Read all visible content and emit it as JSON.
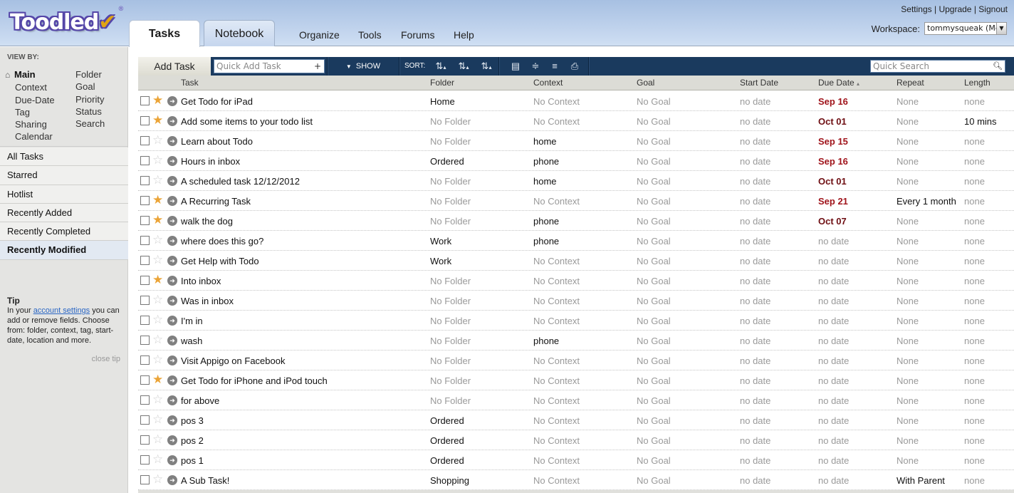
{
  "app": {
    "logo": "Toodled",
    "logo_mark": "✔",
    "logo_reg": "®"
  },
  "tabs": [
    {
      "label": "Tasks",
      "active": true
    },
    {
      "label": "Notebook",
      "active": false
    }
  ],
  "nav": [
    "Organize",
    "Tools",
    "Forums",
    "Help"
  ],
  "top_links": {
    "settings": "Settings",
    "upgrade": "Upgrade",
    "signout": "Signout",
    "separator": "|"
  },
  "workspace": {
    "label": "Workspace:",
    "value": "tommysqueak (Me)"
  },
  "sidebar": {
    "viewby_title": "VIEW BY:",
    "viewby_left": [
      "Main",
      "Context",
      "Due-Date",
      "Tag",
      "Sharing",
      "Calendar"
    ],
    "viewby_right": [
      "Folder",
      "Goal",
      "Priority",
      "Status",
      "Search"
    ],
    "lists": [
      {
        "label": "All Tasks",
        "selected": false
      },
      {
        "label": "Starred",
        "selected": false
      },
      {
        "label": "Hotlist",
        "selected": false
      },
      {
        "label": "Recently Added",
        "selected": false
      },
      {
        "label": "Recently Completed",
        "selected": false
      },
      {
        "label": "Recently Modified",
        "selected": true
      }
    ],
    "tip": {
      "title": "Tip",
      "before_link": "In your ",
      "link": "account settings",
      "after_link": " you can add or remove fields. Choose from: folder, context, tag, start-date, location and more.",
      "close": "close tip"
    }
  },
  "toolbar": {
    "add_task": "Add Task",
    "quick_add_placeholder": "Quick Add Task",
    "show": "SHOW",
    "sort_label": "SORT:",
    "quick_search_placeholder": "Quick Search"
  },
  "columns": [
    "Task",
    "Folder",
    "Context",
    "Goal",
    "Start Date",
    "Due Date",
    "Repeat",
    "Length"
  ],
  "sorted_column_indicator": "▴",
  "tasks": [
    {
      "starred": true,
      "name": "Get Todo for iPad",
      "folder": "Home",
      "context": "No Context",
      "goal": "No Goal",
      "start": "no date",
      "due": "Sep 16",
      "repeat": "None",
      "length": "none"
    },
    {
      "starred": true,
      "name": "Add some items to your todo list",
      "folder": "No Folder",
      "context": "No Context",
      "goal": "No Goal",
      "start": "no date",
      "due": "Oct 01",
      "repeat": "None",
      "length": "10 mins"
    },
    {
      "starred": false,
      "name": "Learn about Todo",
      "folder": "No Folder",
      "context": "home",
      "goal": "No Goal",
      "start": "no date",
      "due": "Sep 15",
      "repeat": "None",
      "length": "none"
    },
    {
      "starred": false,
      "name": "Hours in inbox",
      "folder": "Ordered",
      "context": "phone",
      "goal": "No Goal",
      "start": "no date",
      "due": "Sep 16",
      "repeat": "None",
      "length": "none"
    },
    {
      "starred": false,
      "name": "A scheduled task 12/12/2012",
      "folder": "No Folder",
      "context": "home",
      "goal": "No Goal",
      "start": "no date",
      "due": "Oct 01",
      "repeat": "None",
      "length": "none"
    },
    {
      "starred": true,
      "name": "A Recurring Task",
      "folder": "No Folder",
      "context": "No Context",
      "goal": "No Goal",
      "start": "no date",
      "due": "Sep 21",
      "repeat": "Every 1 month",
      "length": "none"
    },
    {
      "starred": true,
      "name": "walk the dog",
      "folder": "No Folder",
      "context": "phone",
      "goal": "No Goal",
      "start": "no date",
      "due": "Oct 07",
      "repeat": "None",
      "length": "none"
    },
    {
      "starred": false,
      "name": "where does this go?",
      "folder": "Work",
      "context": "phone",
      "goal": "No Goal",
      "start": "no date",
      "due": "no date",
      "repeat": "None",
      "length": "none"
    },
    {
      "starred": false,
      "name": "Get Help with Todo",
      "folder": "Work",
      "context": "No Context",
      "goal": "No Goal",
      "start": "no date",
      "due": "no date",
      "repeat": "None",
      "length": "none"
    },
    {
      "starred": true,
      "name": "Into inbox",
      "folder": "No Folder",
      "context": "No Context",
      "goal": "No Goal",
      "start": "no date",
      "due": "no date",
      "repeat": "None",
      "length": "none"
    },
    {
      "starred": false,
      "name": "Was in inbox",
      "folder": "No Folder",
      "context": "No Context",
      "goal": "No Goal",
      "start": "no date",
      "due": "no date",
      "repeat": "None",
      "length": "none"
    },
    {
      "starred": false,
      "name": "I'm in",
      "folder": "No Folder",
      "context": "No Context",
      "goal": "No Goal",
      "start": "no date",
      "due": "no date",
      "repeat": "None",
      "length": "none"
    },
    {
      "starred": false,
      "name": "wash",
      "folder": "No Folder",
      "context": "phone",
      "goal": "No Goal",
      "start": "no date",
      "due": "no date",
      "repeat": "None",
      "length": "none"
    },
    {
      "starred": false,
      "name": "Visit Appigo on Facebook",
      "folder": "No Folder",
      "context": "No Context",
      "goal": "No Goal",
      "start": "no date",
      "due": "no date",
      "repeat": "None",
      "length": "none"
    },
    {
      "starred": true,
      "name": "Get Todo for iPhone and iPod touch",
      "folder": "No Folder",
      "context": "No Context",
      "goal": "No Goal",
      "start": "no date",
      "due": "no date",
      "repeat": "None",
      "length": "none"
    },
    {
      "starred": false,
      "name": "for above",
      "folder": "No Folder",
      "context": "No Context",
      "goal": "No Goal",
      "start": "no date",
      "due": "no date",
      "repeat": "None",
      "length": "none"
    },
    {
      "starred": false,
      "name": "pos 3",
      "folder": "Ordered",
      "context": "No Context",
      "goal": "No Goal",
      "start": "no date",
      "due": "no date",
      "repeat": "None",
      "length": "none"
    },
    {
      "starred": false,
      "name": "pos 2",
      "folder": "Ordered",
      "context": "No Context",
      "goal": "No Goal",
      "start": "no date",
      "due": "no date",
      "repeat": "None",
      "length": "none"
    },
    {
      "starred": false,
      "name": "pos 1",
      "folder": "Ordered",
      "context": "No Context",
      "goal": "No Goal",
      "start": "no date",
      "due": "no date",
      "repeat": "None",
      "length": "none"
    },
    {
      "starred": false,
      "name": "A Sub Task!",
      "folder": "Shopping",
      "context": "No Context",
      "goal": "No Goal",
      "start": "no date",
      "due": "no date",
      "repeat": "With Parent",
      "length": "none"
    }
  ],
  "colors": {
    "header_blue": "#a7c0e2",
    "toolbar_navy": "#1a3a5e",
    "star_gold": "#eba437",
    "due_red": "#a0141b",
    "muted_gray": "#9a9a9a",
    "selected_list_bg": "#e2e9f2",
    "link_blue": "#2a66c4"
  }
}
